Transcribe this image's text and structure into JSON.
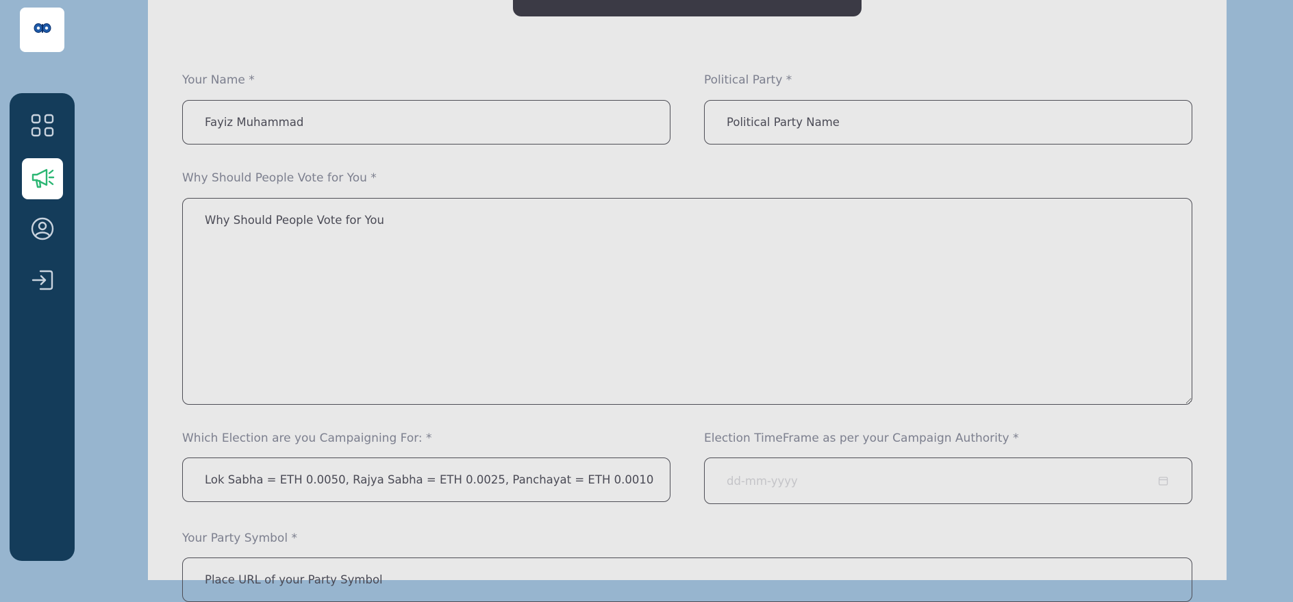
{
  "logo": {
    "icon": "butterfly-logo-icon",
    "colors": {
      "primary": "#1e5aa8",
      "outline": "#0a2f6b"
    }
  },
  "sidebar": {
    "items": [
      {
        "name": "dashboard",
        "icon": "grid-icon",
        "active": false
      },
      {
        "name": "campaign",
        "icon": "megaphone-icon",
        "active": true
      },
      {
        "name": "profile",
        "icon": "user-circle-icon",
        "active": false
      },
      {
        "name": "logout",
        "icon": "sign-in-icon",
        "active": false
      }
    ],
    "colors": {
      "background": "#143c5a",
      "icon": "#c9d3de",
      "active_icon": "#2bb673"
    }
  },
  "form": {
    "name": {
      "label": "Your Name *",
      "value": "Fayiz Muhammad"
    },
    "party": {
      "label": "Political Party *",
      "placeholder": "Political Party Name"
    },
    "why": {
      "label": "Why Should People Vote for You *",
      "placeholder": "Why Should People Vote for You"
    },
    "election": {
      "label": "Which Election are you Campaigning For: *",
      "placeholder": "Lok Sabha = ETH 0.0050, Rajya Sabha = ETH 0.0025, Panchayat = ETH 0.0010"
    },
    "timeframe": {
      "label": "Election TimeFrame as per your Campaign Authority *",
      "placeholder": "dd-mm-yyyy",
      "icon": "calendar-icon"
    },
    "symbol": {
      "label": "Your Party Symbol *",
      "placeholder": "Place URL of your Party Symbol"
    }
  },
  "colors": {
    "page_background": "#97b5cf",
    "panel_background": "#e8e8e8",
    "top_bar": "#3b3a45",
    "label_text": "#7c7f8e",
    "input_border": "#4d4d55"
  }
}
